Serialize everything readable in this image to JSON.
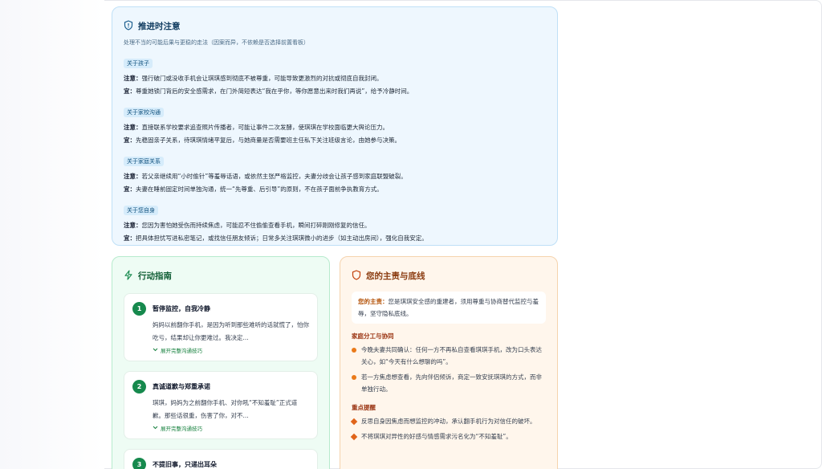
{
  "caution": {
    "title": "推进时注意",
    "subtitle": "处理不当的可能后果与更稳的走法（因案而异，不依赖是否选择前置看板）",
    "sections": [
      {
        "tag": "关于孩子",
        "note_label": "注意：",
        "note": "强行破门或没收手机会让琪琪感到彻底不被尊重，可能导致更激烈的对抗或彻底自我封闭。",
        "advice_label": "宜：",
        "advice": "尊重她锁门背后的安全感需求，在门外简短表达“我在乎你，等你愿意出来时我们再说”，给予冷静时间。"
      },
      {
        "tag": "关于家校沟通",
        "note_label": "注意：",
        "note": "直接联系学校要求追查照片传播者，可能让事件二次发酵，使琪琪在学校面临更大舆论压力。",
        "advice_label": "宜：",
        "advice": "先稳固亲子关系，待琪琪情绪平复后，与她商量是否需要班主任私下关注班级言论，由她参与决策。"
      },
      {
        "tag": "关于家庭关系",
        "note_label": "注意：",
        "note": "若父亲继续用“小时偷针”等羞辱话语，或依然主张严格监控，夫妻分歧会让孩子感到家庭联盟破裂。",
        "advice_label": "宜：",
        "advice": "夫妻在睡前固定时间单独沟通，统一“先尊重、后引导”的原则，不在孩子面前争执教育方式。"
      },
      {
        "tag": "关于您自身",
        "note_label": "注意：",
        "note": "您因为害怕她受伤而持续焦虑，可能忍不住偷偷查看手机，瞬间打碎刚刚修复的信任。",
        "advice_label": "宜：",
        "advice": "把具体担忧写进私密笔记，或找信任朋友倾诉；日常多关注琪琪微小的进步（如主动出房间），强化自我安定。"
      }
    ]
  },
  "action": {
    "title": "行动指南",
    "expand_label": "展开完整沟通技巧",
    "steps": [
      {
        "num": "1",
        "title": "暂停监控，自我冷静",
        "text": "妈妈以前翻你手机，是因为听到那些难听的话就慌了，怕你吃亏，结果却让你更难过。我决定..."
      },
      {
        "num": "2",
        "title": "真诚道歉与郑重承诺",
        "text": "琪琪，妈妈为之前翻你手机、对你吼“不知羞耻”正式道歉。那些话很重，伤害了你，对不..."
      },
      {
        "num": "3",
        "title": "不提旧事，只递出耳朵",
        "text": ""
      }
    ]
  },
  "duty": {
    "title": "您的主责与底线",
    "main_label": "您的主责：",
    "main_text": "您是琪琪安全感的重建者，须用尊重与协商替代监控与羞辱，坚守隐私底线。",
    "division_title": "家庭分工与协同",
    "division_items": [
      "今晚夫妻共同确认：任何一方不再私自查看琪琪手机，改为口头表达关心，如“今天有什么想聊的吗”。",
      "若一方焦虑想查看，先向伴侣倾诉，商定一致安抚琪琪的方式，而非单独行动。"
    ],
    "reminder_title": "重点提醒",
    "reminder_items": [
      "反思自身因焦虑而想监控的冲动，承认翻手机行为对信任的破坏。",
      "不将琪琪对异性的好感与情感需求污名化为“不知羞耻”。"
    ]
  },
  "colors": {
    "caution_bg": "#eef7fe",
    "action_bg": "#eefcf4",
    "duty_bg": "#fff6ec",
    "step_number": "#16894d"
  },
  "icons": {
    "caution": "shield-icon",
    "action": "lightning-icon",
    "duty": "shield-icon",
    "expand": "chevron-down-icon"
  }
}
